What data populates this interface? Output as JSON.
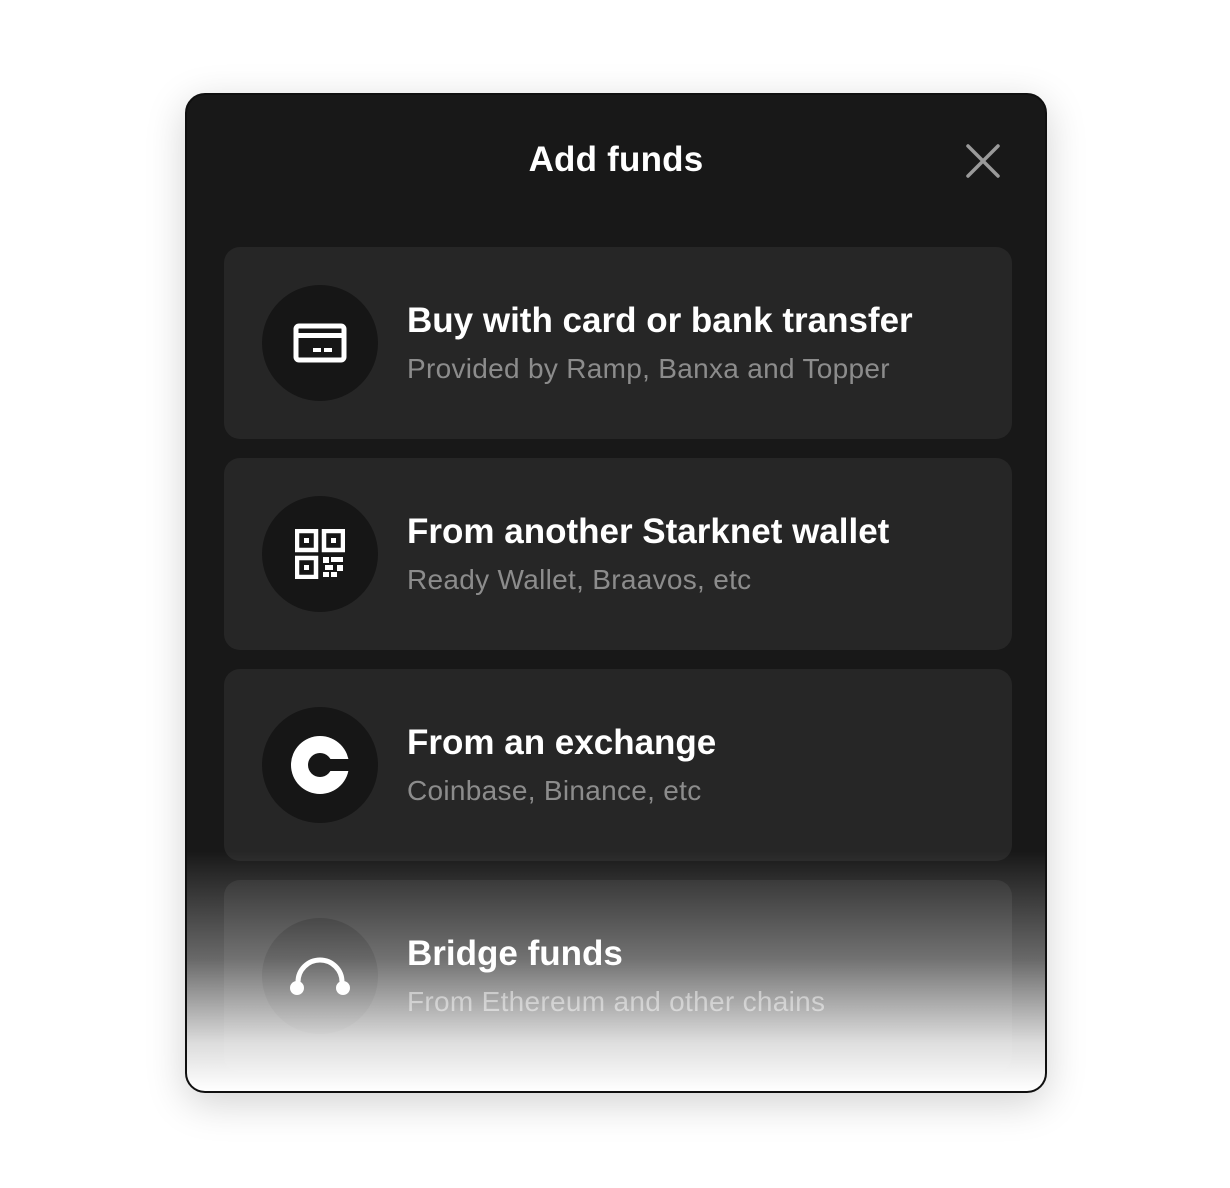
{
  "modal": {
    "title": "Add funds",
    "close_icon": "close-icon"
  },
  "options": [
    {
      "icon": "credit-card-icon",
      "title": "Buy with card or bank transfer",
      "subtitle": "Provided by Ramp, Banxa and Topper"
    },
    {
      "icon": "qr-code-icon",
      "title": "From another Starknet wallet",
      "subtitle": "Ready Wallet, Braavos, etc"
    },
    {
      "icon": "coinbase-icon",
      "title": "From an exchange",
      "subtitle": "Coinbase, Binance, etc"
    },
    {
      "icon": "bridge-icon",
      "title": "Bridge funds",
      "subtitle": "From Ethereum and other chains"
    }
  ],
  "colors": {
    "modal_bg": "#181818",
    "card_bg": "#262626",
    "icon_circle_bg": "#161616",
    "title_text": "#ffffff",
    "subtitle_text": "#8c8c8c"
  }
}
